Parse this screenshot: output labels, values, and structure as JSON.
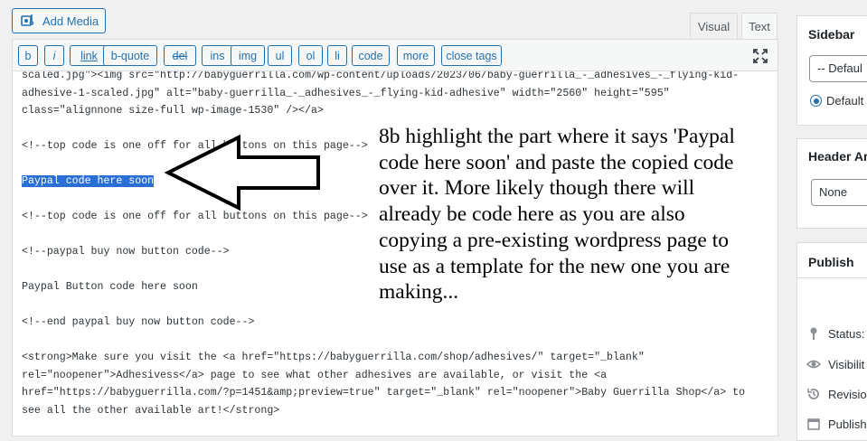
{
  "toolbar": {
    "add_media_label": "Add Media",
    "tab_visual": "Visual",
    "tab_text": "Text"
  },
  "quicktags": [
    "b",
    "i",
    "link",
    "b-quote",
    "del",
    "ins",
    "img",
    "ul",
    "ol",
    "li",
    "code",
    "more",
    "close tags"
  ],
  "code_lines": [
    "scaled.jpg\"><img src=\"http://babyguerrilla.com/wp-content/uploads/2023/06/baby-guerrilla_-_adhesives_-_flying-kid-",
    "adhesive-1-scaled.jpg\" alt=\"baby-guerrilla_-_adhesives_-_flying-kid-adhesive\" width=\"2560\" height=\"595\"",
    "class=\"alignnone size-full wp-image-1530\" /></a>",
    "",
    "<!--top code is one off for all buttons on this page-->",
    "",
    "Paypal code here soon",
    "",
    "<!--top code is one off for all buttons on this page-->",
    "",
    "<!--paypal buy now button code-->",
    "",
    "Paypal Button code here soon",
    "",
    "<!--end paypal buy now button code-->",
    "",
    "<strong>Make sure you visit the <a href=\"https://babyguerrilla.com/shop/adhesives/\" target=\"_blank\"",
    "rel=\"noopener\">Adhesivess</a> page to see what other adhesives are available, or visit the <a",
    "href=\"https://babyguerrilla.com/?p=1451&amp;preview=true\" target=\"_blank\" rel=\"noopener\">Baby Guerrilla Shop</a> to",
    "see all the other available art!</strong>"
  ],
  "selected_text": "Paypal code here soon",
  "annotation_lines": [
    "8b highlight the part where it says 'Paypal",
    "code here soon' and paste the copied code",
    "over it. More likely though there will",
    "already be code here as you are also",
    "copying a pre-existing wordpress page to",
    "use as a template for the new one you are",
    "making..."
  ],
  "sidebar": {
    "sidebar_title": "Sidebar",
    "sidebar_select_value": "-- Defaul",
    "sidebar_radio_label": "Default",
    "header_title": "Header Ar",
    "header_select_value": "None",
    "publish_title": "Publish",
    "publish_rows": [
      "Status:",
      "Visibilit",
      "Revision",
      "Publish"
    ]
  },
  "colors": {
    "accent": "#2271b1",
    "selection": "#2a6fd6",
    "panel_bg": "#f0f0f1"
  }
}
